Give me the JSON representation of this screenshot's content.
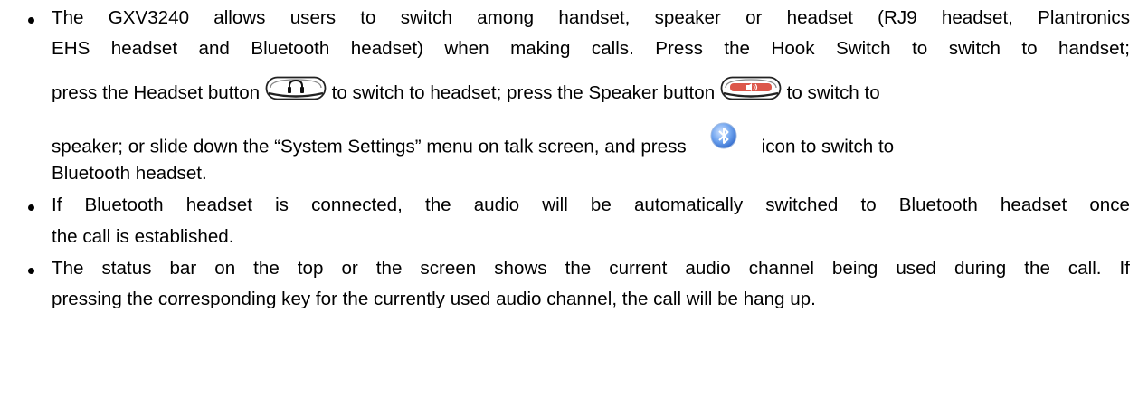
{
  "bullets": [
    {
      "lines": [
        "The GXV3240 allows users to switch among handset, speaker or headset (RJ9 headset, Plantronics",
        "EHS headset and Bluetooth headset) when making calls. Press the Hook Switch to switch to handset;"
      ],
      "line3": {
        "a": "press the Headset button",
        "b": "to switch to headset; press the Speaker button",
        "c": "to switch to"
      },
      "line4": {
        "a": "speaker; or slide down the “System Settings” menu on talk screen, and press",
        "b": "icon to switch to"
      },
      "line5": "Bluetooth headset."
    },
    {
      "lines": [
        "If Bluetooth headset is connected, the audio will be automatically switched to Bluetooth headset once",
        "the call is established."
      ]
    },
    {
      "lines": [
        "The status bar on the top or the screen shows the current audio channel being used during the call. If",
        "pressing the corresponding key for the currently used audio channel, the call will be hang up."
      ]
    }
  ],
  "icons": {
    "headset_button": "headset-key-icon",
    "speaker_button": "speaker-key-icon",
    "bluetooth": "bluetooth-icon"
  },
  "colors": {
    "text": "#000000",
    "key_border": "#222222",
    "bluetooth_blue": "#3a7be0"
  }
}
